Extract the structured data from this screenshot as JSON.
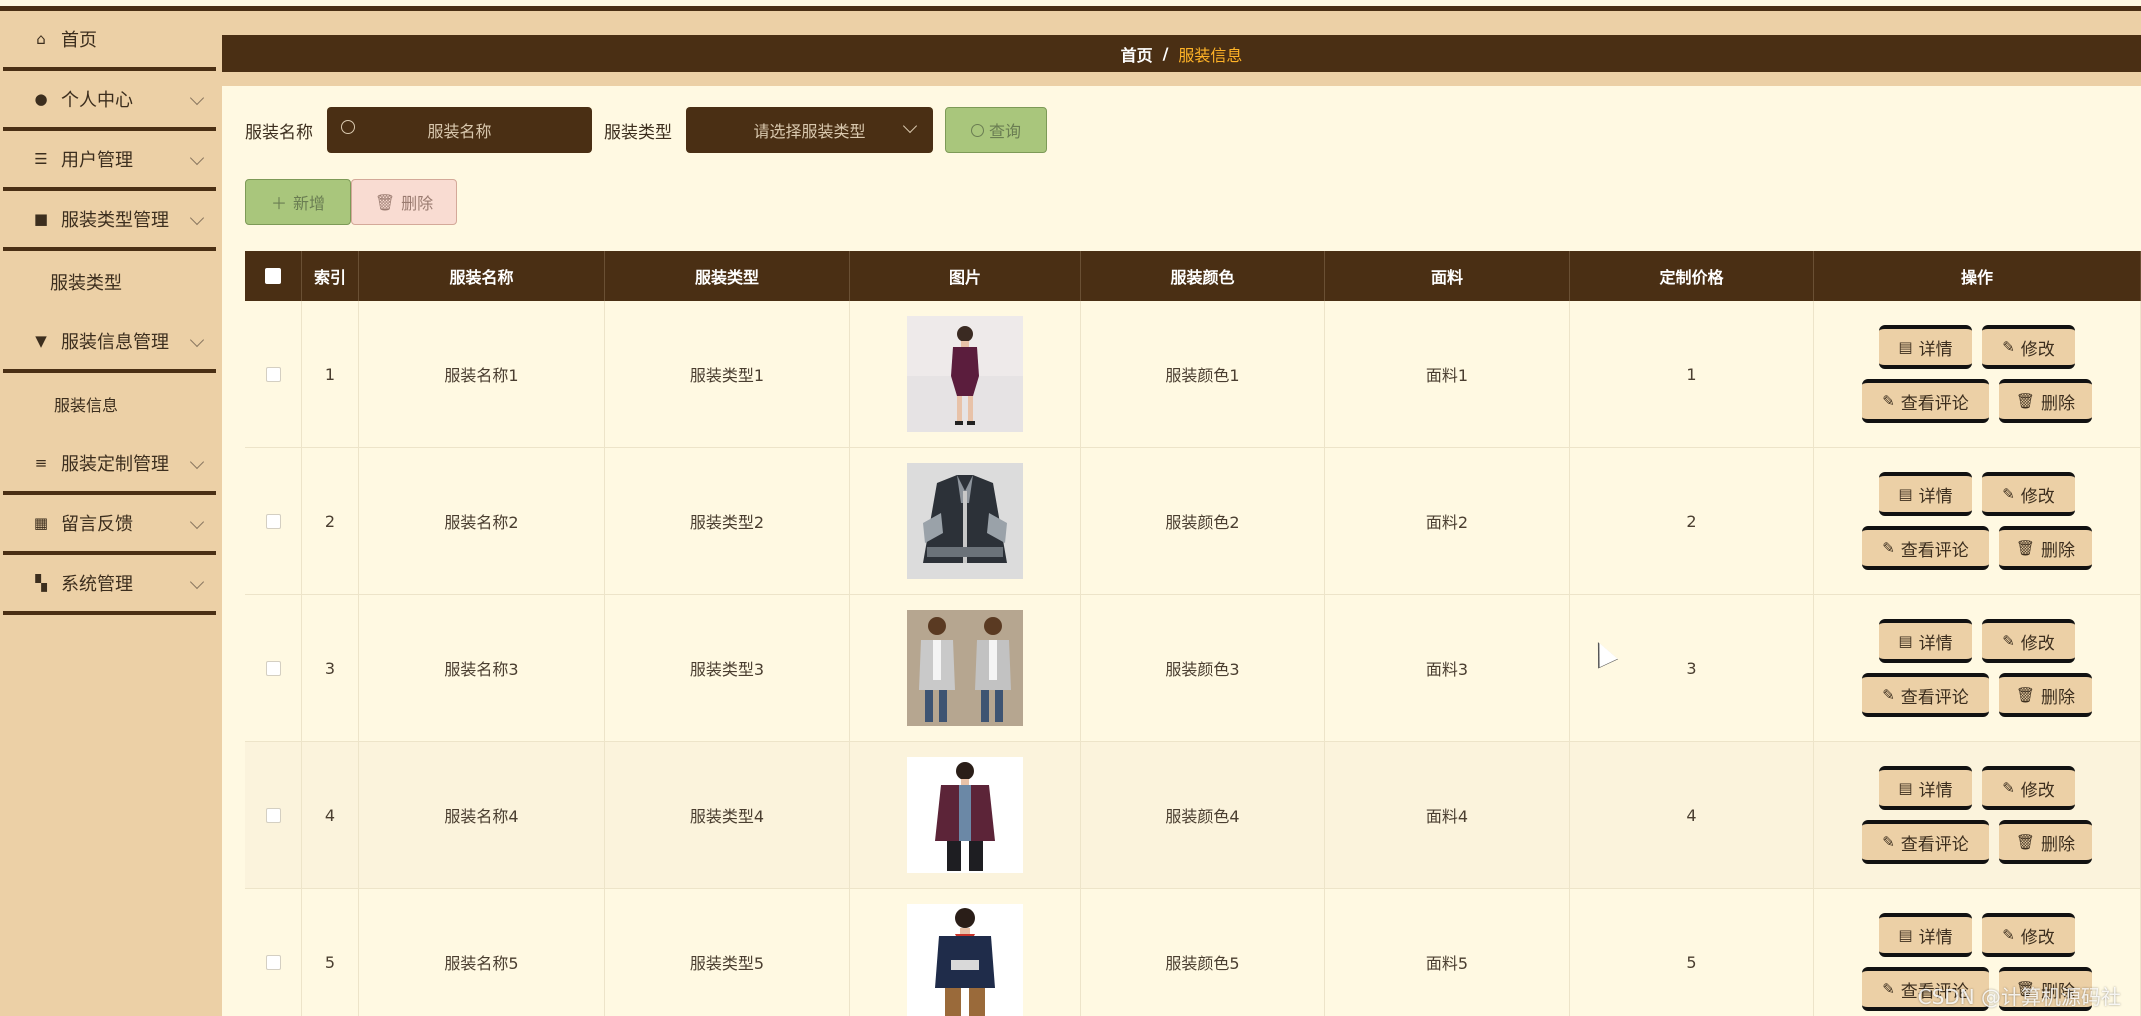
{
  "sidebar": {
    "items": [
      {
        "label": "首页",
        "icon": "home-icon"
      },
      {
        "label": "个人中心",
        "icon": "user-icon"
      },
      {
        "label": "用户管理",
        "icon": "sliders-icon"
      },
      {
        "label": "服装类型管理",
        "icon": "briefcase-icon"
      },
      {
        "label": "服装信息管理",
        "icon": "pin-icon"
      },
      {
        "label": "服装定制管理",
        "icon": "list-icon"
      },
      {
        "label": "留言反馈",
        "icon": "grid-icon"
      },
      {
        "label": "系统管理",
        "icon": "apps-icon"
      }
    ],
    "sub_clothing_type": "服装类型",
    "sub_clothing_info": "服装信息"
  },
  "breadcrumb": {
    "home": "首页",
    "separator": "/",
    "current": "服装信息"
  },
  "search": {
    "name_label": "服装名称",
    "name_placeholder": "服装名称",
    "type_label": "服装类型",
    "type_placeholder": "请选择服装类型",
    "query_label": "查询"
  },
  "actions": {
    "add_label": "新增",
    "delete_label": "删除"
  },
  "table": {
    "headers": [
      "索引",
      "服装名称",
      "服装类型",
      "图片",
      "服装颜色",
      "面料",
      "定制价格",
      "操作"
    ],
    "rows": [
      {
        "index": "1",
        "name": "服装名称1",
        "type": "服装类型1",
        "color": "服装颜色1",
        "fabric": "面料1",
        "price": "1"
      },
      {
        "index": "2",
        "name": "服装名称2",
        "type": "服装类型2",
        "color": "服装颜色2",
        "fabric": "面料2",
        "price": "2"
      },
      {
        "index": "3",
        "name": "服装名称3",
        "type": "服装类型3",
        "color": "服装颜色3",
        "fabric": "面料3",
        "price": "3"
      },
      {
        "index": "4",
        "name": "服装名称4",
        "type": "服装类型4",
        "color": "服装颜色4",
        "fabric": "面料4",
        "price": "4"
      },
      {
        "index": "5",
        "name": "服装名称5",
        "type": "服装类型5",
        "color": "服装颜色5",
        "fabric": "面料5",
        "price": "5"
      }
    ],
    "ops": {
      "detail": "详情",
      "edit": "修改",
      "comments": "查看评论",
      "delete": "删除"
    }
  },
  "watermark": "CSDN @计算机源码社",
  "colors": {
    "brand_dark": "#4a2f14",
    "sidebar_bg": "#ecd0a6",
    "content_bg": "#fff9e2",
    "accent": "#ffb327"
  }
}
